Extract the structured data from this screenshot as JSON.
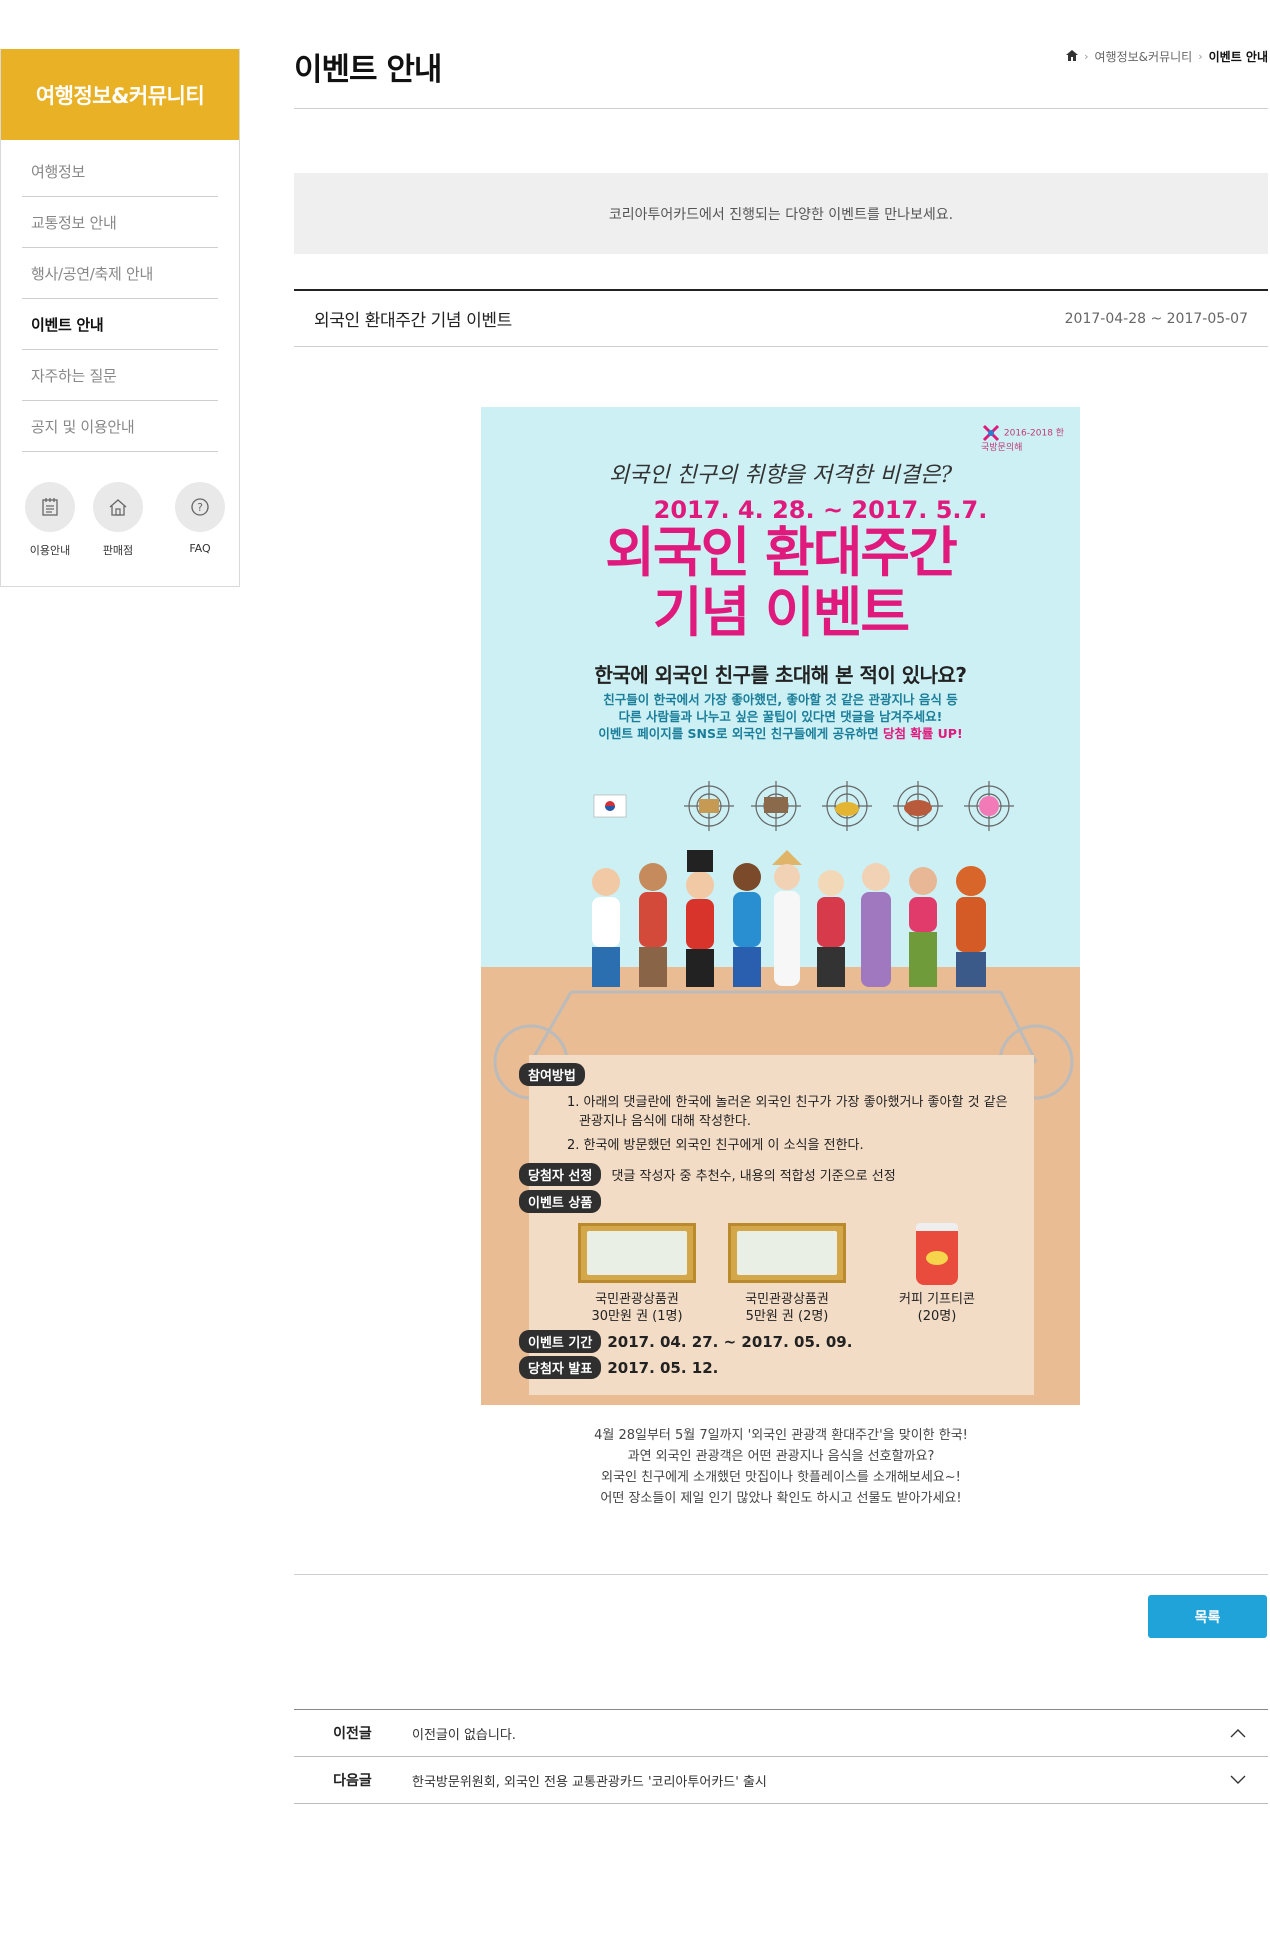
{
  "sidebar": {
    "title": "여행정보&커뮤니티",
    "items": [
      {
        "label": "여행정보"
      },
      {
        "label": "교통정보 안내"
      },
      {
        "label": "행사/공연/축제 안내"
      },
      {
        "label": "이벤트 안내"
      },
      {
        "label": "자주하는 질문"
      },
      {
        "label": "공지 및 이용안내"
      }
    ],
    "active_item": "이벤트 안내",
    "quick_links": [
      {
        "label": "이용안내",
        "icon": "guide-icon"
      },
      {
        "label": "판매점",
        "icon": "home-icon"
      },
      {
        "label": "FAQ",
        "icon": "question-icon"
      }
    ]
  },
  "header": {
    "page_title": "이벤트 안내",
    "breadcrumb": {
      "home_icon": "home-icon",
      "level1": "여행정보&커뮤니티",
      "current": "이벤트 안내"
    }
  },
  "intro": {
    "text": "코리아투어카드에서 진행되는 다양한 이벤트를 만나보세요."
  },
  "post": {
    "title": "외국인 환대주간 기념 이벤트",
    "date_range": "2017-04-28 ~ 2017-05-07"
  },
  "poster": {
    "logo_text": "2016-2018 한국방문의해",
    "tagline": "외국인 친구의 취향을 저격한 비결은?",
    "dates": "2017. 4. 28. ~ 2017. 5.7.",
    "title_line1": "외국인 환대주간",
    "title_line2": "기념 이벤트",
    "question": "한국에 외국인 친구를 초대해 본 적이 있나요?",
    "desc_line1": "친구들이 한국에서 가장 좋아했던, 좋아할 것 같은 관광지나 음식 등",
    "desc_line2": "다른 사람들과 나누고 싶은 꿀팁이 있다면 댓글을 남겨주세요!",
    "desc_line3_pre": "이벤트 페이지를 SNS로 외국인 친구들에게 공유하면 ",
    "desc_line3_hl": "당첨 확률 UP!",
    "how_tag": "참여방법",
    "how_1a": "1. 아래의 댓글란에  한국에 놀러온 외국인 친구가 가장 좋아했거나 좋아할 것 같은",
    "how_1b": "관광지나 음식에 대해 작성한다.",
    "how_2": "2. 한국에 방문했던 외국인 친구에게 이 소식을 전한다.",
    "winner_tag": "당첨자 선정",
    "winner_text": "댓글 작성자 중 추천수, 내용의 적합성 기준으로 선정",
    "prize_tag": "이벤트 상품",
    "prizes": [
      {
        "name": "국민관광상품권",
        "detail": "30만원 권 (1명)"
      },
      {
        "name": "국민관광상품권",
        "detail": "5만원 권 (2명)"
      },
      {
        "name": "커피 기프티콘",
        "detail": "(20명)"
      }
    ],
    "period_tag": "이벤트 기간",
    "period_text": "2017. 04. 27. ~ 2017. 05. 09.",
    "announce_tag": "당첨자 발표",
    "announce_text": "2017. 05. 12.",
    "colors": {
      "sky": "#cdf0f4",
      "ground": "#e9bc93",
      "accent": "#e0197d"
    }
  },
  "caption": {
    "line1": "4월 28일부터 5월 7일까지 '외국인 관광객 환대주간'을 맞이한 한국!",
    "line2": "과연 외국인 관광객은 어떤 관광지나 음식을 선호할까요?",
    "line3": "외국인 친구에게 소개했던 맛집이나 핫플레이스를 소개해보세요~!",
    "line4": "어떤 장소들이 제일 인기 많았나 확인도 하시고 선물도 받아가세요!"
  },
  "list_button": {
    "label": "목록"
  },
  "nav": {
    "prev_label": "이전글",
    "prev_text": "이전글이 없습니다.",
    "next_label": "다음글",
    "next_text": "한국방문위원회, 외국인 전용 교통관광카드 '코리아투어카드' 출시"
  },
  "colors": {
    "brand": "#e9b125",
    "button": "#1fa3d8"
  }
}
